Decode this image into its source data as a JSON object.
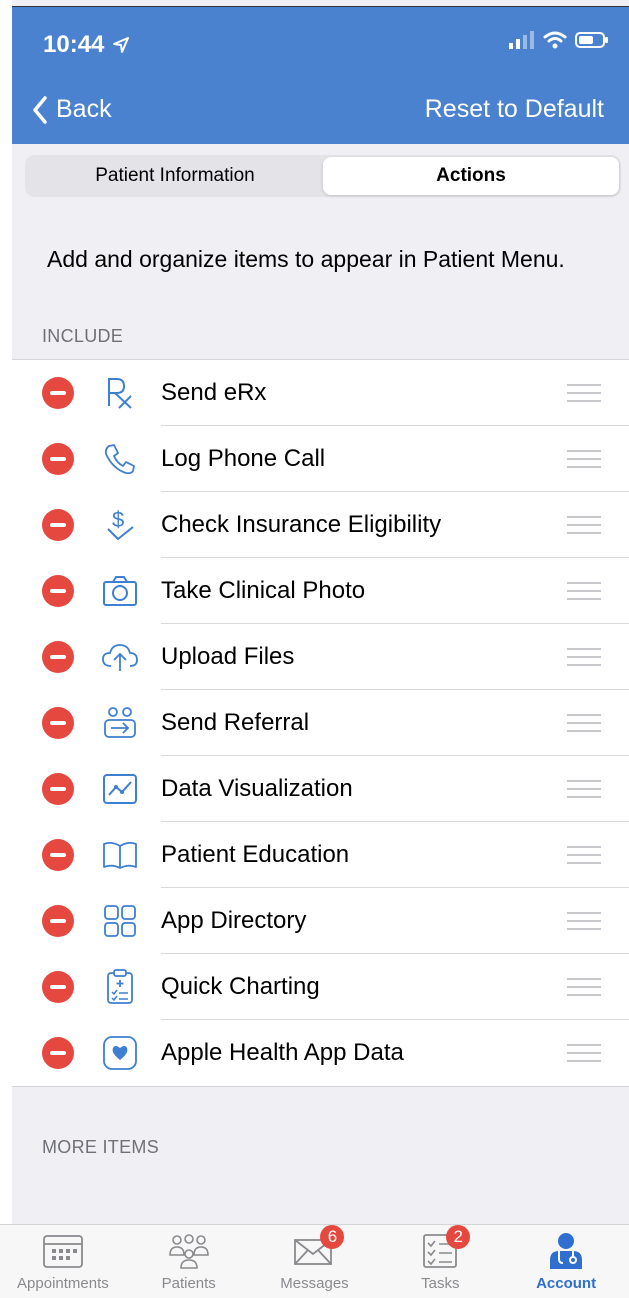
{
  "status_bar": {
    "time": "10:44"
  },
  "nav": {
    "back_label": "Back",
    "reset_label": "Reset to Default"
  },
  "segments": [
    {
      "label": "Patient Information",
      "active": false
    },
    {
      "label": "Actions",
      "active": true
    }
  ],
  "instructions": "Add and organize items to appear in Patient Menu.",
  "include_section": {
    "header": "INCLUDE",
    "items": [
      {
        "label": "Send eRx",
        "icon": "rx-icon"
      },
      {
        "label": "Log Phone Call",
        "icon": "phone-icon"
      },
      {
        "label": "Check Insurance Eligibility",
        "icon": "dollar-check-icon"
      },
      {
        "label": "Take Clinical Photo",
        "icon": "camera-icon"
      },
      {
        "label": "Upload Files",
        "icon": "cloud-upload-icon"
      },
      {
        "label": "Send Referral",
        "icon": "referral-icon"
      },
      {
        "label": "Data Visualization",
        "icon": "chart-icon"
      },
      {
        "label": "Patient Education",
        "icon": "book-icon"
      },
      {
        "label": "App Directory",
        "icon": "grid-icon"
      },
      {
        "label": "Quick Charting",
        "icon": "clipboard-icon"
      },
      {
        "label": "Apple Health App Data",
        "icon": "heart-icon"
      }
    ]
  },
  "more_section": {
    "header": "MORE ITEMS"
  },
  "tabbar": {
    "tabs": [
      {
        "label": "Appointments",
        "badge": "",
        "active": false
      },
      {
        "label": "Patients",
        "badge": "",
        "active": false
      },
      {
        "label": "Messages",
        "badge": "6",
        "active": false
      },
      {
        "label": "Tasks",
        "badge": "2",
        "active": false
      },
      {
        "label": "Account",
        "badge": "",
        "active": true
      }
    ]
  },
  "colors": {
    "header_bg": "#4b82cf",
    "accent": "#3e7fd1",
    "remove": "#e5483f"
  }
}
